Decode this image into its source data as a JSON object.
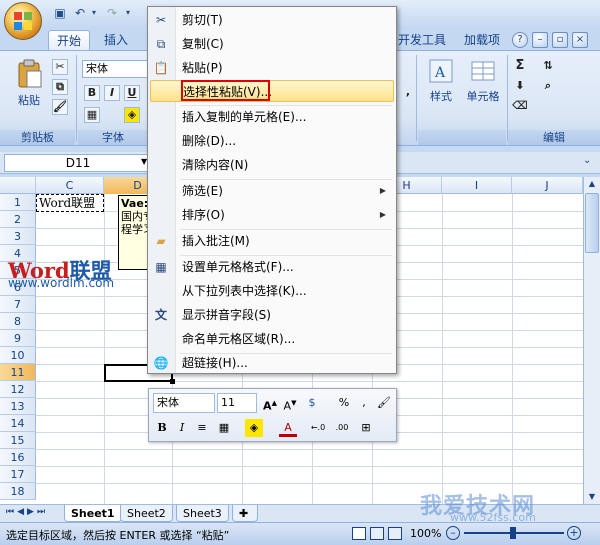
{
  "quick_access": {
    "save_icon": "save-icon",
    "undo_icon": "undo-icon",
    "redo_icon": "redo-icon"
  },
  "tabs": {
    "home": "开始",
    "insert": "插入",
    "developer": "开发工具",
    "addins": "加载项"
  },
  "ribbon": {
    "paste_label": "粘贴",
    "clipboard_label": "剪贴板",
    "font_label": "字体",
    "font_name": "宋体",
    "style_label": "样式",
    "cells_label": "单元格",
    "edit_label": "编辑"
  },
  "formula_bar": {
    "namebox": "D11"
  },
  "grid": {
    "columns": [
      "C",
      "D",
      "",
      "",
      "",
      "H",
      "I",
      "J"
    ],
    "rows": [
      "1",
      "2",
      "3",
      "4",
      "5",
      "6",
      "7",
      "8",
      "9",
      "10",
      "11",
      "12",
      "13",
      "14",
      "15",
      "16",
      "17",
      "18"
    ],
    "cell_c1": "Word联盟",
    "comment_line1": "Vae:",
    "comment_line2": "国内专",
    "comment_line3": "程学习"
  },
  "context_menu": {
    "items": [
      {
        "label": "剪切(T)",
        "icon": "scissors-icon"
      },
      {
        "label": "复制(C)",
        "icon": "copy-icon"
      },
      {
        "label": "粘贴(P)",
        "icon": "paste-icon"
      },
      {
        "label": "选择性粘贴(V)...",
        "icon": ""
      },
      {
        "label": "插入复制的单元格(E)...",
        "icon": ""
      },
      {
        "label": "删除(D)...",
        "icon": ""
      },
      {
        "label": "清除内容(N)",
        "icon": ""
      },
      {
        "label": "筛选(E)",
        "icon": ""
      },
      {
        "label": "排序(O)",
        "icon": ""
      },
      {
        "label": "插入批注(M)",
        "icon": "comment-icon"
      },
      {
        "label": "设置单元格格式(F)...",
        "icon": "format-cells-icon"
      },
      {
        "label": "从下拉列表中选择(K)...",
        "icon": ""
      },
      {
        "label": "显示拼音字段(S)",
        "icon": "phonetic-icon"
      },
      {
        "label": "命名单元格区域(R)...",
        "icon": ""
      },
      {
        "label": "超链接(H)...",
        "icon": "hyperlink-icon"
      }
    ]
  },
  "mini_toolbar": {
    "font": "宋体",
    "size": "11",
    "percent": "%"
  },
  "sheets": [
    "Sheet1",
    "Sheet2",
    "Sheet3"
  ],
  "status": {
    "text": "选定目标区域，然后按 ENTER 或选择 “粘贴”",
    "zoom": "100%"
  },
  "watermarks": {
    "word_a": "Word",
    "word_b": "联盟",
    "url": "www.wordlm.com",
    "site": "我爱技术网",
    "site_sub": "www.52fss.com"
  }
}
